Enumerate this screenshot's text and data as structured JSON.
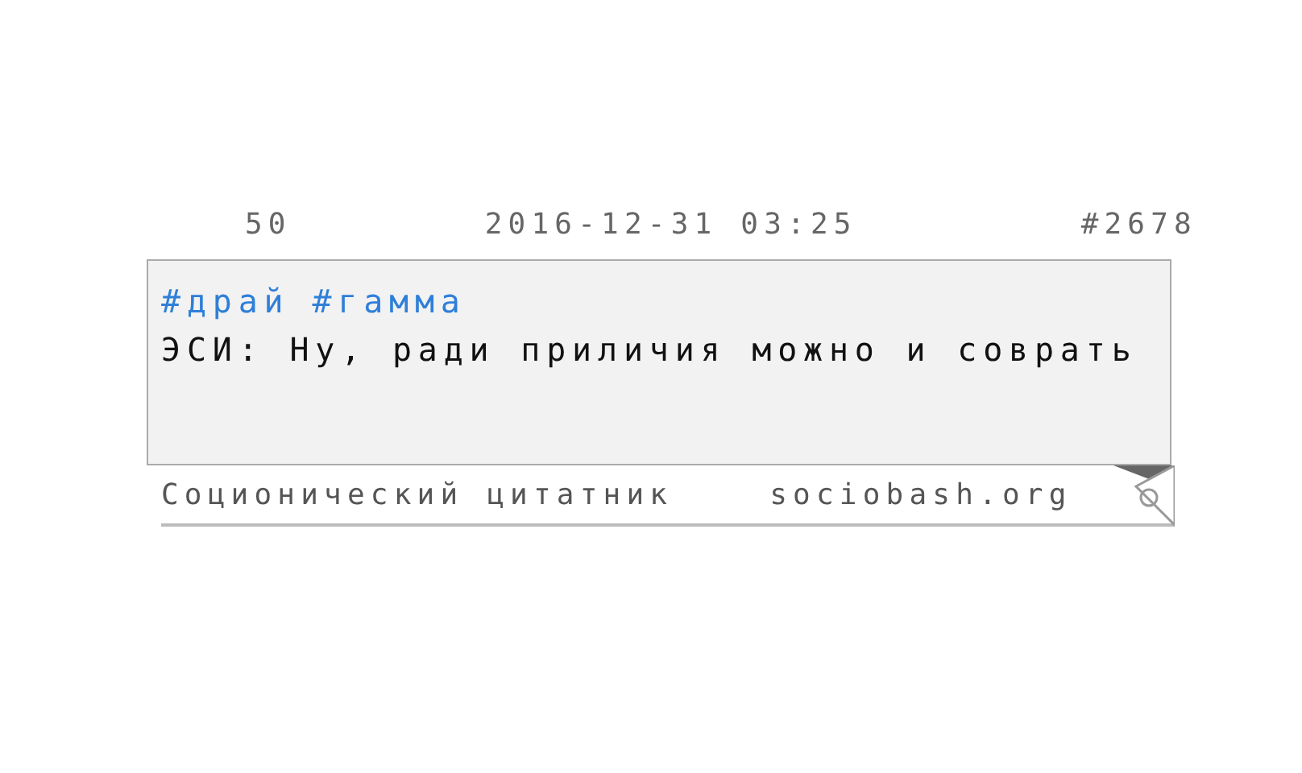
{
  "header": {
    "rating": "50",
    "date": "2016-12-31 03:25",
    "number": "#2678"
  },
  "quote": {
    "tags": [
      "#драй",
      "#гамма"
    ],
    "text": "ЭСИ: Ну, ради приличия можно и соврать"
  },
  "footer": {
    "site_name": "Соционический цитатник",
    "domain": "sociobash.org"
  }
}
